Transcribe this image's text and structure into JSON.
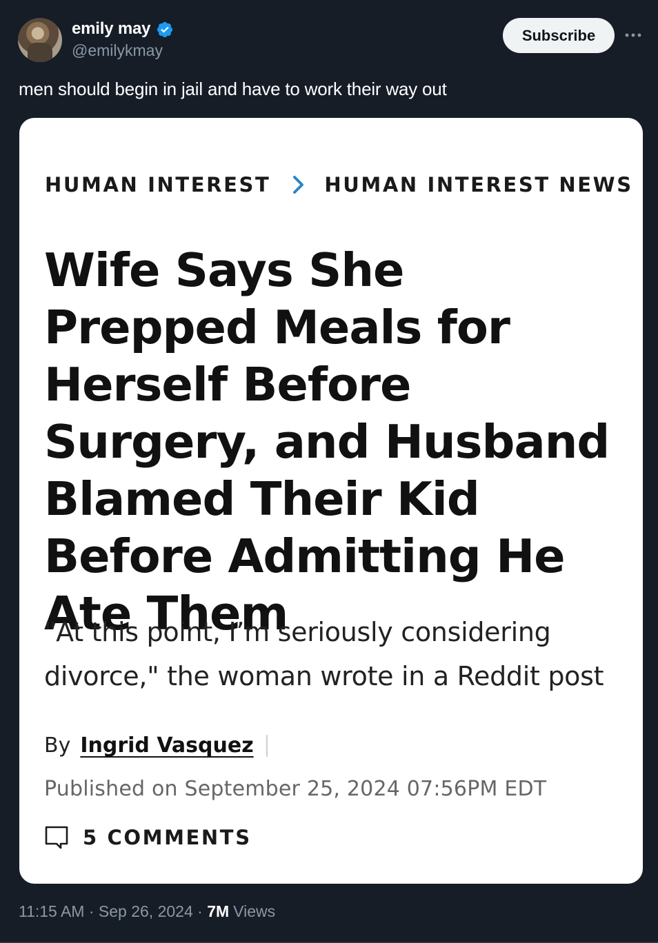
{
  "post": {
    "author_name": "emily may",
    "author_handle": "@emilykmay",
    "subscribe_label": "Subscribe",
    "text": "men should begin in jail and have to work their way out",
    "timestamp": "11:15 AM · Sep 26, 2024 · ",
    "views_count": "7M",
    "views_label": "Views"
  },
  "article": {
    "breadcrumb_1": "HUMAN INTEREST",
    "breadcrumb_2": "HUMAN INTEREST NEWS",
    "headline": "Wife Says She Prepped Meals for Herself Before Surgery, and Husband Blamed Their Kid Before Admitting He Ate Them",
    "dek": "\"At this point, I’m seriously considering divorce,\" the woman wrote in a Reddit post",
    "by_label": "By",
    "author": "Ingrid Vasquez",
    "published": "Published on September 25, 2024 07:56PM EDT",
    "comments_label": "5 COMMENTS"
  },
  "colors": {
    "background": "#161d27",
    "card": "#ffffff",
    "verified": "#1d9bf0",
    "chevron": "#2a86c7"
  },
  "icons": {
    "verified": "verified-badge-icon",
    "more": "more-dots-icon",
    "breadcrumb_separator": "chevron-right-icon",
    "comments": "comment-bubble-icon"
  }
}
